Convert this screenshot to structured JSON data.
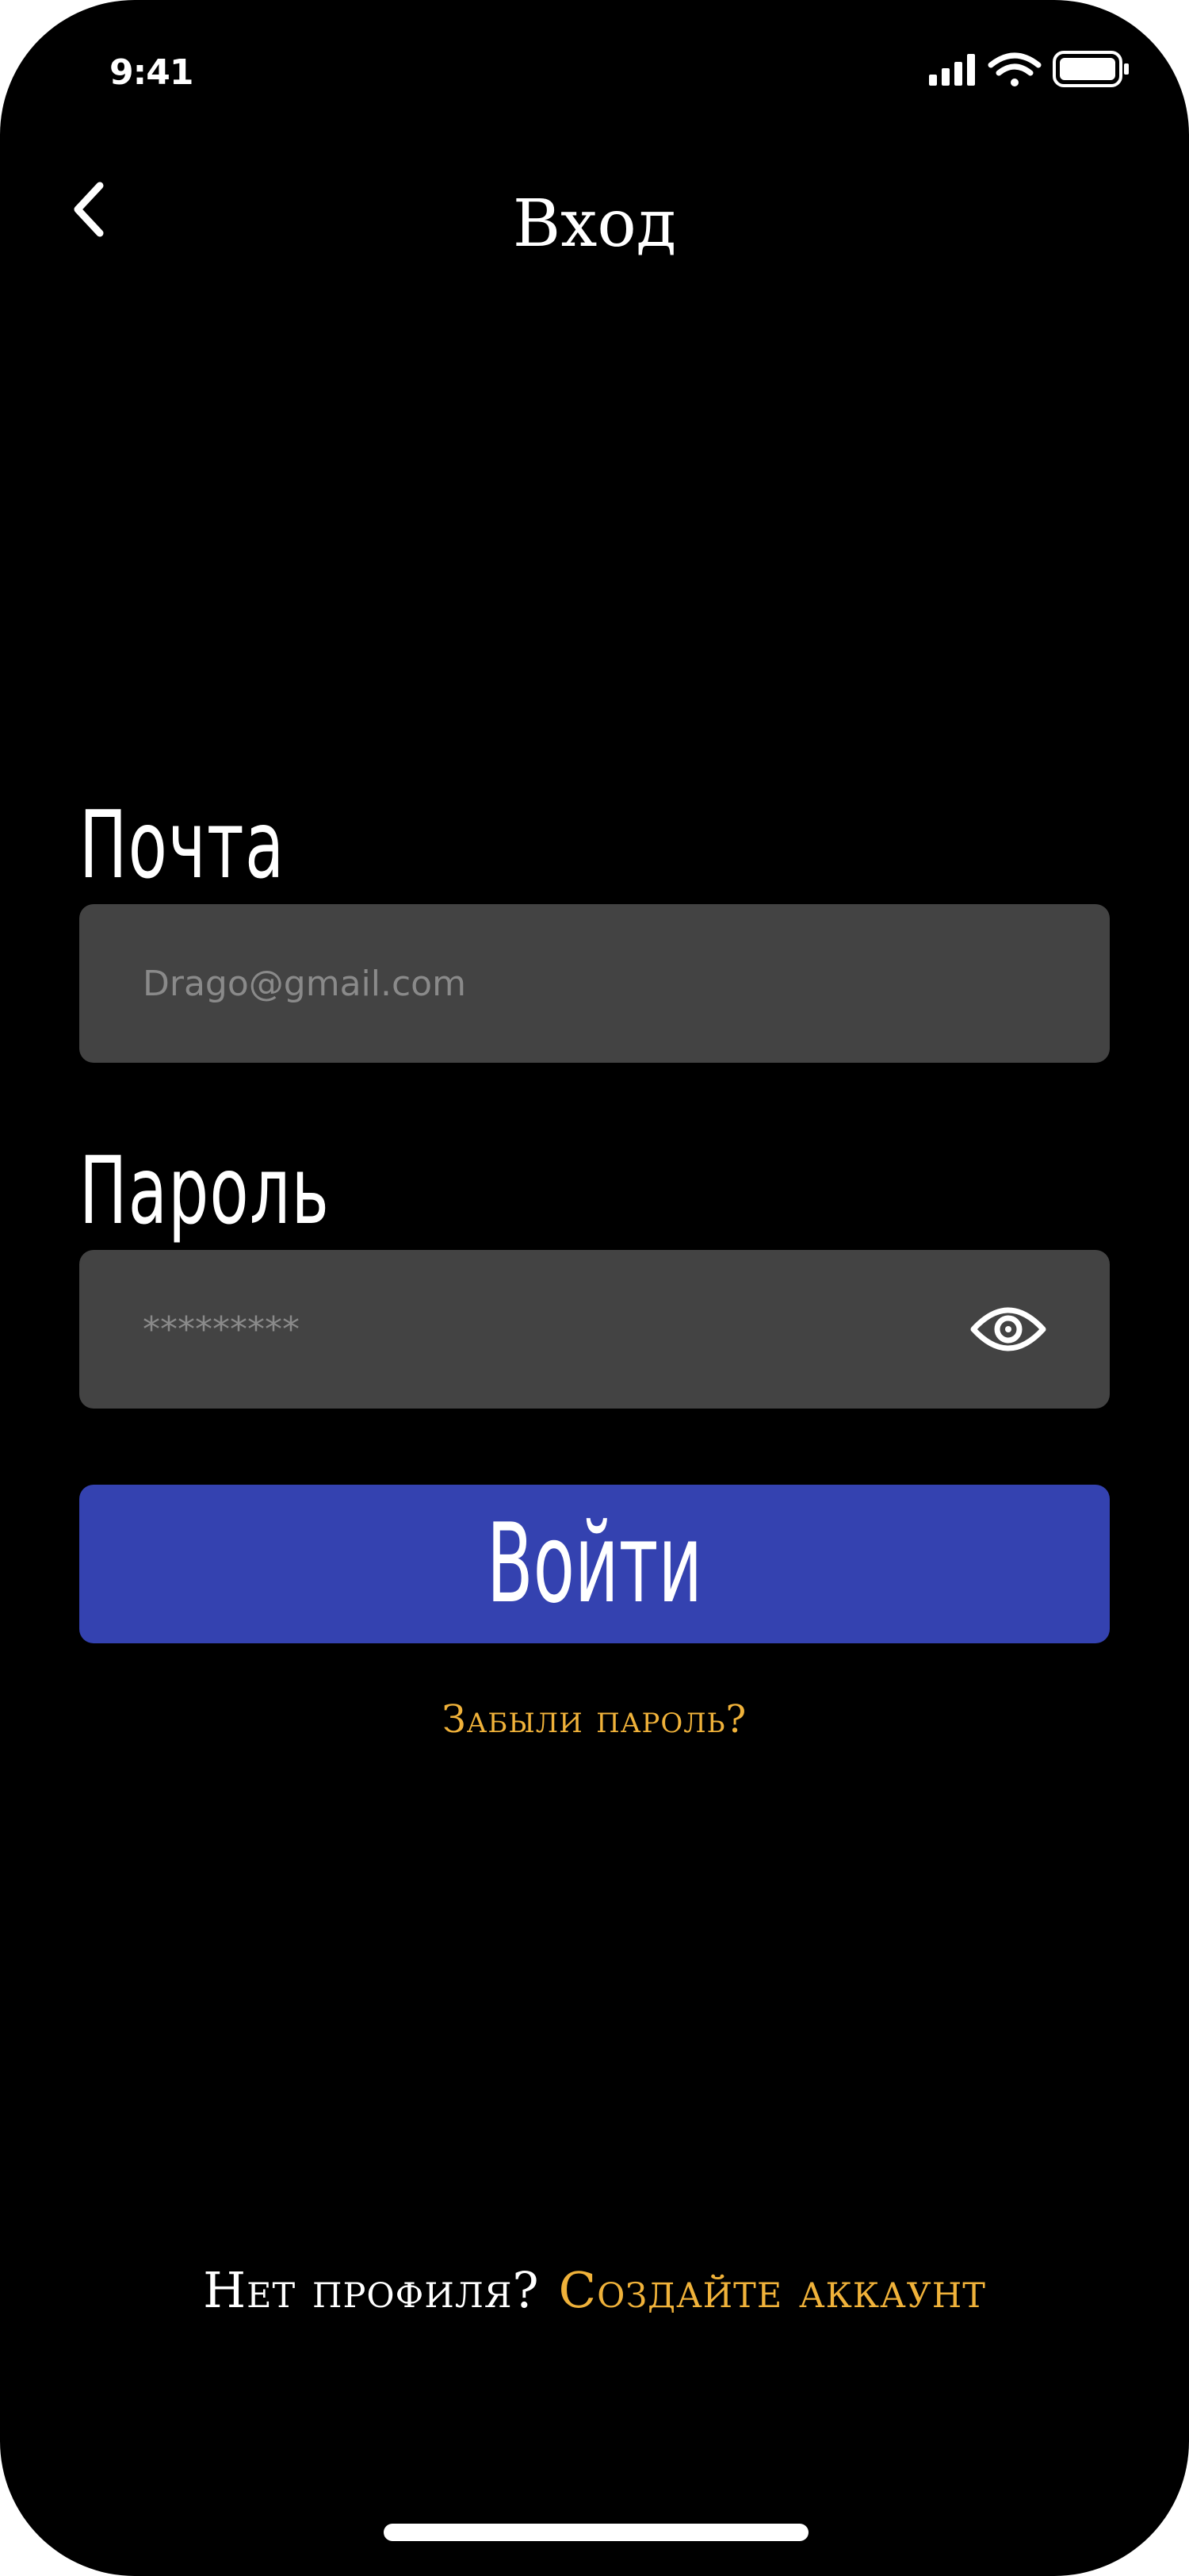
{
  "status_bar": {
    "time": "9:41",
    "icons": [
      "signal-icon",
      "wifi-icon",
      "battery-icon"
    ]
  },
  "nav": {
    "title": "Вход",
    "back_icon": "chevron-left-icon"
  },
  "form": {
    "email": {
      "label": "Почта",
      "placeholder": "Drago@gmail.com"
    },
    "password": {
      "label": "Пароль",
      "placeholder": "*********",
      "toggle_icon": "eye-icon"
    },
    "submit_label": "Войти",
    "forgot_label": "Забыли пароль?"
  },
  "footer": {
    "prompt": "Нет профиля?",
    "link": "Создайте аккаунт"
  },
  "colors": {
    "background": "#000000",
    "input_background": "#434343",
    "button": "#3442b0",
    "accent": "#f0b23a",
    "text": "#ffffff"
  }
}
